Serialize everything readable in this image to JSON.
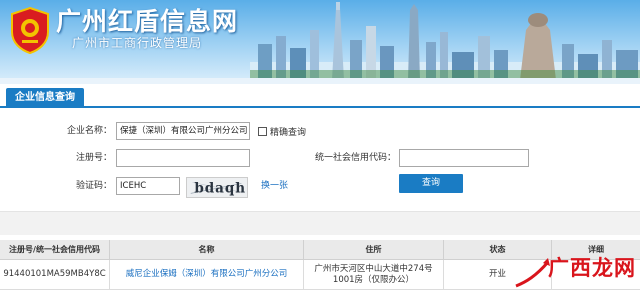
{
  "header": {
    "title": "广州红盾信息网",
    "subtitle": "广州市工商行政管理局"
  },
  "tabs": [
    {
      "label": "企业信息查询",
      "active": true
    }
  ],
  "form": {
    "company_name": {
      "label": "企业名称：",
      "value": "保捷（深圳）有限公司广州分公司"
    },
    "exact_match": {
      "label": "精确查询",
      "checked": false
    },
    "reg_no": {
      "label": "注册号：",
      "value": ""
    },
    "credit_code": {
      "label": "统一社会信用代码：",
      "value": ""
    },
    "captcha": {
      "label": "验证码：",
      "value": "ICEHC",
      "image_text": "bdaqh"
    },
    "refresh_label": "换一张",
    "query_button": "查询"
  },
  "table": {
    "headers": [
      "注册号/统一社会信用代码",
      "名称",
      "住所",
      "状态",
      "详细"
    ],
    "rows": [
      {
        "reg_no": "91440101MA59MB4Y8C",
        "name": "威尼企业保姆（深圳）有限公司广州分公司",
        "address": "广州市天河区中山大道中274号1001房（仅限办公）",
        "status": "开业",
        "detail": ""
      }
    ]
  },
  "watermark": {
    "text": "广西龙网"
  },
  "colors": {
    "accent": "#1a7cc4",
    "link": "#1a6fc0",
    "banner_sky": "#5aaee8",
    "watermark_red": "#d9151c"
  }
}
